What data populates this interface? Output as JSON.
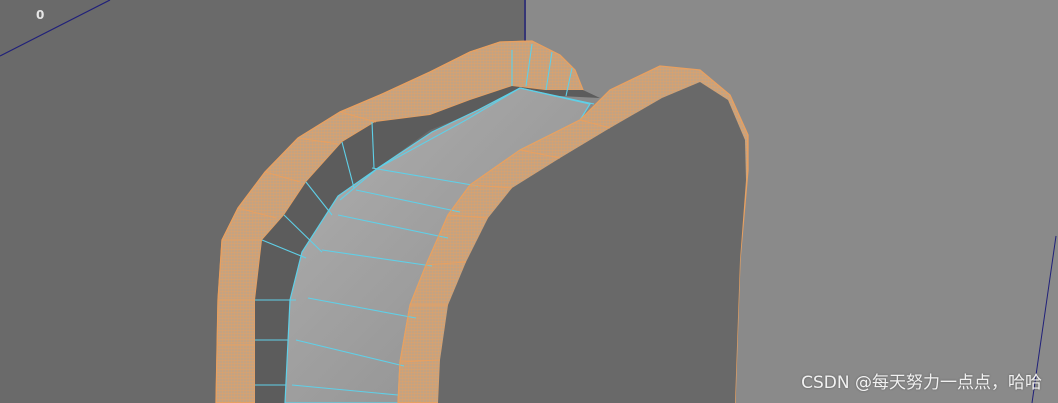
{
  "viewport": {
    "hud_label": "0",
    "watermark": "CSDN @每天努力一点点，哈哈"
  },
  "colors": {
    "background": "#6a6a6a",
    "backdrop_right": "#8a8a8a",
    "inner_face": "#a0a0a0",
    "selected_edge": "#e8a060",
    "wire_edge": "#5fd0e8",
    "axis_line": "#20207a"
  },
  "icons": []
}
